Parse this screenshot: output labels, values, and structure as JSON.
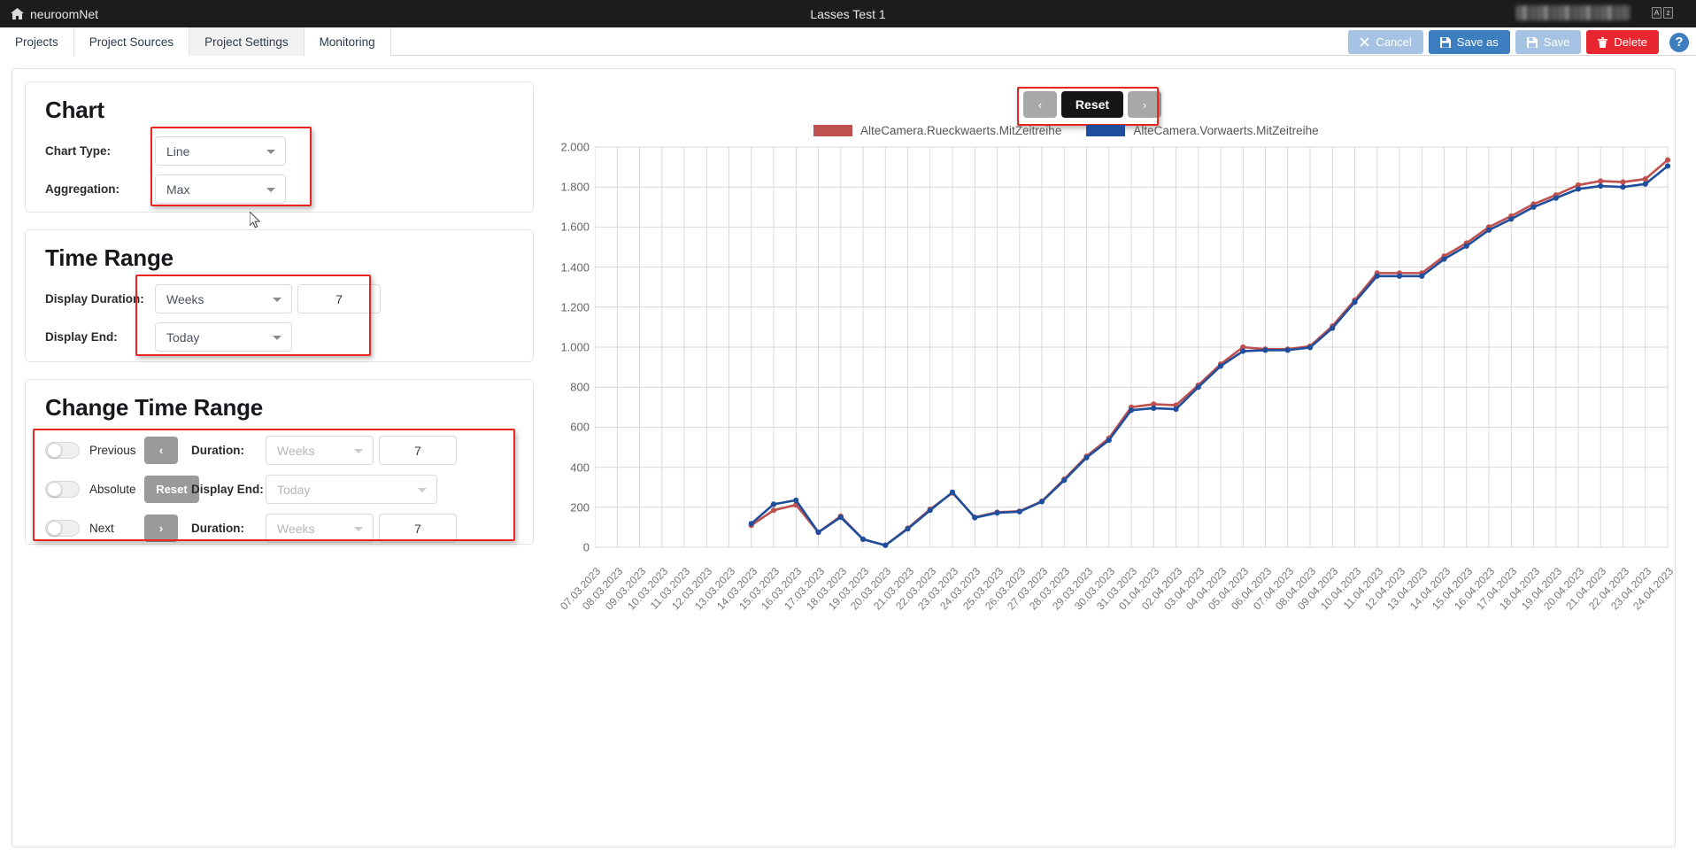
{
  "topbar": {
    "brand": "neuroomNet",
    "home_icon": "home-icon",
    "title": "Lasses Test 1",
    "user_name": "",
    "lang_icon_a": "A",
    "lang_icon_z": "z"
  },
  "tabs": [
    {
      "label": "Projects",
      "active": false
    },
    {
      "label": "Project Sources",
      "active": false
    },
    {
      "label": "Project Settings",
      "active": true
    },
    {
      "label": "Monitoring",
      "active": false
    }
  ],
  "actions": {
    "cancel": "Cancel",
    "save_as": "Save as",
    "save": "Save",
    "delete": "Delete",
    "help": "?"
  },
  "chart_card": {
    "title": "Chart",
    "chart_type_label": "Chart Type:",
    "chart_type_value": "Line",
    "aggregation_label": "Aggregation:",
    "aggregation_value": "Max"
  },
  "time_range_card": {
    "title": "Time Range",
    "display_duration_label": "Display Duration:",
    "display_duration_unit": "Weeks",
    "display_duration_count": "7",
    "display_end_label": "Display End:",
    "display_end_value": "Today"
  },
  "change_time_range_card": {
    "title": "Change Time Range",
    "rows": [
      {
        "toggle_name": "Previous",
        "button_label": "‹",
        "field_label": "Duration:",
        "select_value": "Weeks",
        "number_value": "7"
      },
      {
        "toggle_name": "Absolute",
        "button_label": "Reset",
        "field_label": "Display End:",
        "select_value": "Today",
        "number_value": ""
      },
      {
        "toggle_name": "Next",
        "button_label": "›",
        "field_label": "Duration:",
        "select_value": "Weeks",
        "number_value": "7"
      }
    ]
  },
  "chart_nav": {
    "prev": "‹",
    "reset": "Reset",
    "next": "›"
  },
  "chart_data": {
    "type": "line",
    "title": "",
    "xlabel": "",
    "ylabel": "",
    "ylim": [
      0,
      2000
    ],
    "yticks": [
      0,
      200,
      400,
      600,
      800,
      1000,
      1200,
      1400,
      1600,
      1800,
      2000
    ],
    "ytick_labels": [
      "0",
      "200",
      "400",
      "600",
      "800",
      "1.000",
      "1.200",
      "1.400",
      "1.600",
      "1.800",
      "2.000"
    ],
    "grid": true,
    "legend_position": "top",
    "colors": {
      "series1": "#c0504d",
      "series2": "#1f4e9c"
    },
    "categories": [
      "07.03.2023",
      "08.03.2023",
      "09.03.2023",
      "10.03.2023",
      "11.03.2023",
      "12.03.2023",
      "13.03.2023",
      "14.03.2023",
      "15.03.2023",
      "16.03.2023",
      "17.03.2023",
      "18.03.2023",
      "19.03.2023",
      "20.03.2023",
      "21.03.2023",
      "22.03.2023",
      "23.03.2023",
      "24.03.2023",
      "25.03.2023",
      "26.03.2023",
      "27.03.2023",
      "28.03.2023",
      "29.03.2023",
      "30.03.2023",
      "31.03.2023",
      "01.04.2023",
      "02.04.2023",
      "03.04.2023",
      "04.04.2023",
      "05.04.2023",
      "06.04.2023",
      "07.04.2023",
      "08.04.2023",
      "09.04.2023",
      "10.04.2023",
      "11.04.2023",
      "12.04.2023",
      "13.04.2023",
      "14.04.2023",
      "15.04.2023",
      "16.04.2023",
      "17.04.2023",
      "18.04.2023",
      "19.04.2023",
      "20.04.2023",
      "21.04.2023",
      "22.04.2023",
      "23.04.2023",
      "24.04.2023"
    ],
    "series": [
      {
        "name": "AlteCamera.Rueckwaerts.MitZeitreihe",
        "color": "#c0504d",
        "values": [
          null,
          null,
          null,
          null,
          null,
          null,
          null,
          110,
          185,
          212,
          75,
          155,
          40,
          10,
          95,
          190,
          272,
          150,
          175,
          180,
          230,
          340,
          455,
          545,
          700,
          715,
          710,
          810,
          915,
          1000,
          990,
          990,
          1005,
          1105,
          1235,
          1370,
          1370,
          1370,
          1455,
          1520,
          1600,
          1655,
          1715,
          1760,
          1810,
          1830,
          1825,
          1840,
          1935
        ]
      },
      {
        "name": "AlteCamera.Vorwaerts.MitZeitreihe",
        "color": "#1f4e9c",
        "values": [
          null,
          null,
          null,
          null,
          null,
          null,
          null,
          118,
          215,
          235,
          75,
          150,
          40,
          10,
          92,
          185,
          275,
          148,
          172,
          178,
          228,
          335,
          448,
          535,
          685,
          695,
          690,
          800,
          905,
          980,
          985,
          985,
          998,
          1095,
          1225,
          1355,
          1355,
          1355,
          1440,
          1505,
          1585,
          1640,
          1700,
          1745,
          1790,
          1805,
          1800,
          1815,
          1905
        ]
      }
    ]
  }
}
